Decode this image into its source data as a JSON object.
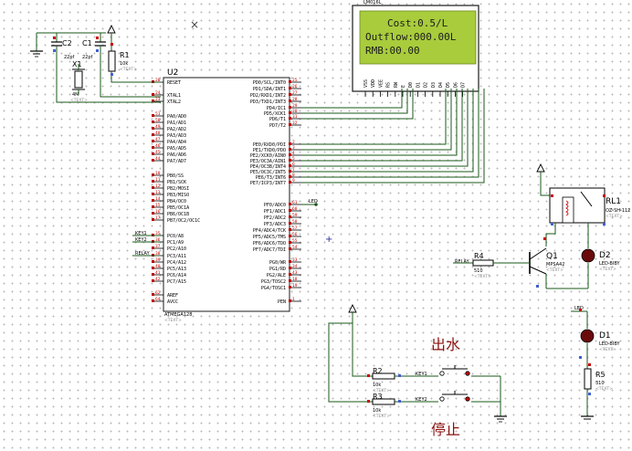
{
  "lcd": {
    "title": "LM016L",
    "line1": "Cost:0.5/L",
    "line2": "Outflow:000.00L",
    "line3": "RMB:00.00",
    "pins": [
      "VSS",
      "VDD",
      "VEE",
      "RS",
      "RW",
      "E",
      "D0",
      "D1",
      "D2",
      "D3",
      "D4",
      "D5",
      "D6",
      "D7"
    ]
  },
  "mcu": {
    "ref": "U2",
    "part": "ATMEGA128",
    "text": "<TEXT>",
    "left_pins": [
      {
        "n": "20",
        "l": "RESET"
      },
      {
        "n": "24",
        "l": "XTAL1"
      },
      {
        "n": "23",
        "l": "XTAL2"
      },
      {
        "n": "51",
        "l": "PA0/AD0"
      },
      {
        "n": "50",
        "l": "PA1/AD1"
      },
      {
        "n": "49",
        "l": "PA2/AD2"
      },
      {
        "n": "48",
        "l": "PA3/AD3"
      },
      {
        "n": "47",
        "l": "PA4/AD4"
      },
      {
        "n": "46",
        "l": "PA5/AD5"
      },
      {
        "n": "45",
        "l": "PA6/AD6"
      },
      {
        "n": "44",
        "l": "PA7/AD7"
      },
      {
        "n": "10",
        "l": "PB0/SS"
      },
      {
        "n": "11",
        "l": "PB1/SCK"
      },
      {
        "n": "12",
        "l": "PB2/MOSI"
      },
      {
        "n": "13",
        "l": "PB3/MISO"
      },
      {
        "n": "14",
        "l": "PB4/OC0"
      },
      {
        "n": "15",
        "l": "PB5/OC1A"
      },
      {
        "n": "16",
        "l": "PB6/OC1B"
      },
      {
        "n": "17",
        "l": "PB7/OC2/OC1C"
      },
      {
        "n": "35",
        "l": "PC0/A8"
      },
      {
        "n": "36",
        "l": "PC1/A9"
      },
      {
        "n": "37",
        "l": "PC2/A10"
      },
      {
        "n": "38",
        "l": "PC3/A11"
      },
      {
        "n": "39",
        "l": "PC4/A12"
      },
      {
        "n": "40",
        "l": "PC5/A13"
      },
      {
        "n": "41",
        "l": "PC6/A14"
      },
      {
        "n": "42",
        "l": "PC7/A15"
      },
      {
        "n": "62",
        "l": "AREF"
      },
      {
        "n": "64",
        "l": "AVCC"
      }
    ],
    "right_pins": [
      {
        "n": "25",
        "l": "PD0/SCL/INT0"
      },
      {
        "n": "26",
        "l": "PD1/SDA/INT1"
      },
      {
        "n": "27",
        "l": "PD2/RXD1/INT2"
      },
      {
        "n": "28",
        "l": "PD3/TXD1/INT3"
      },
      {
        "n": "29",
        "l": "PD4/IC1"
      },
      {
        "n": "30",
        "l": "PD5/XCK1"
      },
      {
        "n": "31",
        "l": "PD6/T1"
      },
      {
        "n": "32",
        "l": "PD7/T2"
      },
      {
        "n": "2",
        "l": "PE0/RXD0/PDI"
      },
      {
        "n": "3",
        "l": "PE1/TXD0/PDO"
      },
      {
        "n": "4",
        "l": "PE2/XCK0/AIN0"
      },
      {
        "n": "5",
        "l": "PE3/OC3A/AIN1"
      },
      {
        "n": "6",
        "l": "PE4/OC3B/INT4"
      },
      {
        "n": "7",
        "l": "PE5/OC3C/INT5"
      },
      {
        "n": "8",
        "l": "PE6/T3/INT6"
      },
      {
        "n": "9",
        "l": "PE7/ICP3/INT7"
      },
      {
        "n": "61",
        "l": "PF0/ADC0"
      },
      {
        "n": "60",
        "l": "PF1/ADC1"
      },
      {
        "n": "59",
        "l": "PF2/ADC2"
      },
      {
        "n": "58",
        "l": "PF3/ADC3"
      },
      {
        "n": "57",
        "l": "PF4/ADC4/TCK"
      },
      {
        "n": "56",
        "l": "PF5/ADC5/TMS"
      },
      {
        "n": "55",
        "l": "PF6/ADC6/TDO"
      },
      {
        "n": "54",
        "l": "PF7/ADC7/TDI"
      },
      {
        "n": "33",
        "l": "PG0/WR"
      },
      {
        "n": "34",
        "l": "PG1/RD"
      },
      {
        "n": "43",
        "l": "PG2/ALE"
      },
      {
        "n": "18",
        "l": "PG3/TOSC2"
      },
      {
        "n": "19",
        "l": "PG4/TOSC1"
      },
      {
        "n": "1",
        "l": "PEN"
      }
    ]
  },
  "parts": {
    "c2": {
      "ref": "C2",
      "val": "22pf",
      "text": "<TEXT>"
    },
    "c1": {
      "ref": "C1",
      "val": "22pf",
      "text": "<TEXT>"
    },
    "x1": {
      "ref": "X1",
      "val": "4M",
      "text": "<TEXT>"
    },
    "r1": {
      "ref": "R1",
      "val": "10k",
      "text": "<TEXT>"
    },
    "r2": {
      "ref": "R2",
      "val": "10k",
      "text": "<TEXT>"
    },
    "r3": {
      "ref": "R3",
      "val": "10k",
      "text": "<TEXT>"
    },
    "r4": {
      "ref": "R4",
      "val": "510",
      "text": "<TEXT>"
    },
    "r5": {
      "ref": "R5",
      "val": "310",
      "text": "<TEXT>"
    },
    "q1": {
      "ref": "Q1",
      "val": "MPSA42",
      "text": "<TEXT>"
    },
    "rl1": {
      "ref": "RL1",
      "val": "OZ-SH-112",
      "text": "<TEXT>"
    },
    "d1": {
      "ref": "D1",
      "val": "LED-BIBY",
      "text": "<TEXT>"
    },
    "d2": {
      "ref": "D2",
      "val": "LED-BIBY",
      "text": "<TEXT>"
    }
  },
  "nets": {
    "key1": "KEY1",
    "key2": "KEY2",
    "relay": "RELAY",
    "led": "LED"
  },
  "buttons": {
    "outflow_label": "出水",
    "stop_label": "停止"
  }
}
